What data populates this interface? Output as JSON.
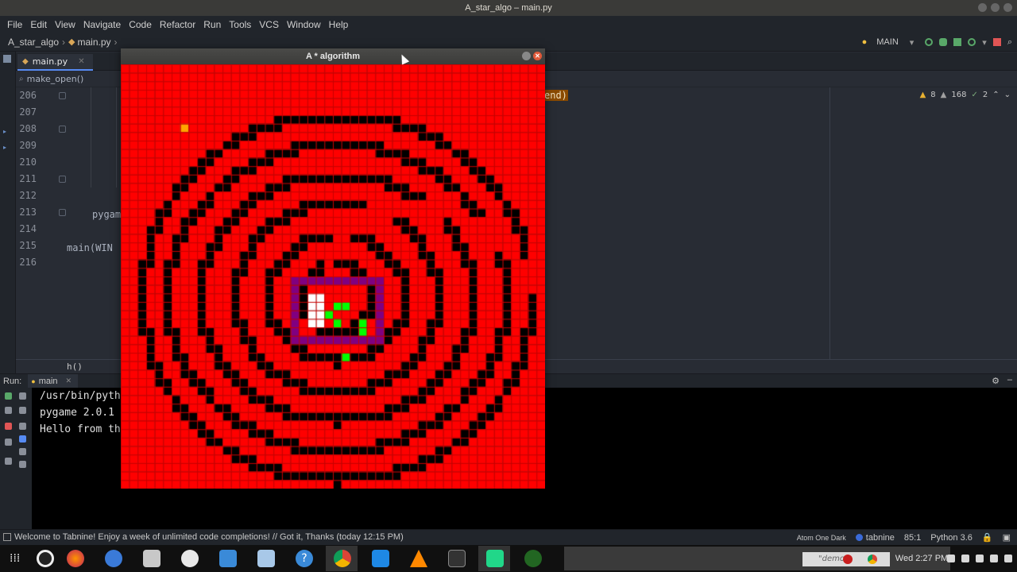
{
  "os": {
    "title": "A_star_algo – main.py"
  },
  "menu": [
    "File",
    "Edit",
    "View",
    "Navigate",
    "Code",
    "Refactor",
    "Run",
    "Tools",
    "VCS",
    "Window",
    "Help"
  ],
  "breadcrumb": {
    "project": "A_star_algo",
    "file": "main.py"
  },
  "toolbar": {
    "run_config": "MAIN"
  },
  "tabs": {
    "active": "main.py"
  },
  "structure": {
    "crumb": "make_open()"
  },
  "editor": {
    "lines": [
      "206",
      "207",
      "208",
      "209",
      "210",
      "211",
      "212",
      "213",
      "214",
      "215",
      "216"
    ],
    "visible_code": {
      "l206": "end)",
      "l213": "pygam",
      "l215": "main(WIN"
    },
    "inspections": {
      "warnings": "8",
      "weak_warnings": "168",
      "typos": "2"
    },
    "footer": "h()"
  },
  "run": {
    "label": "Run:",
    "config": "main",
    "console": [
      "/usr/bin/pyth",
      "pygame 2.0.1",
      "Hello from th"
    ]
  },
  "status": {
    "message": "Welcome to Tabnine! Enjoy a week of unlimited code completions! // Got it, Thanks (today 12:15 PM)",
    "theme": "Atom One Dark",
    "plugin": "tabnine",
    "position": "85:1",
    "interpreter": "Python 3.6"
  },
  "taskbar": {
    "clock": "Wed  2:27 PM",
    "notify": "\"demo"
  },
  "game": {
    "title": "A * algorithm",
    "grid_cols": 50,
    "grid_rows": 50,
    "colors": {
      "visited": "#ff0000",
      "grid_line": "#c80000",
      "barrier": "#000000",
      "path": "#800080",
      "open": "#00ff00",
      "start": "#ffa500",
      "end": "#ffffff"
    },
    "start_cell": [
      7,
      7
    ]
  }
}
